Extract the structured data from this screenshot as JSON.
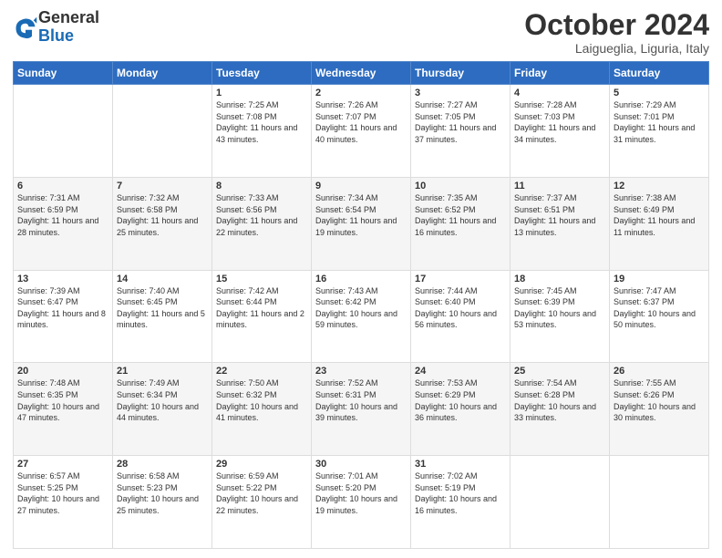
{
  "logo": {
    "line1": "General",
    "line2": "Blue"
  },
  "header": {
    "month": "October 2024",
    "location": "Laigueglia, Liguria, Italy"
  },
  "weekdays": [
    "Sunday",
    "Monday",
    "Tuesday",
    "Wednesday",
    "Thursday",
    "Friday",
    "Saturday"
  ],
  "weeks": [
    [
      {
        "day": null,
        "info": null
      },
      {
        "day": null,
        "info": null
      },
      {
        "day": "1",
        "info": "Sunrise: 7:25 AM\nSunset: 7:08 PM\nDaylight: 11 hours and 43 minutes."
      },
      {
        "day": "2",
        "info": "Sunrise: 7:26 AM\nSunset: 7:07 PM\nDaylight: 11 hours and 40 minutes."
      },
      {
        "day": "3",
        "info": "Sunrise: 7:27 AM\nSunset: 7:05 PM\nDaylight: 11 hours and 37 minutes."
      },
      {
        "day": "4",
        "info": "Sunrise: 7:28 AM\nSunset: 7:03 PM\nDaylight: 11 hours and 34 minutes."
      },
      {
        "day": "5",
        "info": "Sunrise: 7:29 AM\nSunset: 7:01 PM\nDaylight: 11 hours and 31 minutes."
      }
    ],
    [
      {
        "day": "6",
        "info": "Sunrise: 7:31 AM\nSunset: 6:59 PM\nDaylight: 11 hours and 28 minutes."
      },
      {
        "day": "7",
        "info": "Sunrise: 7:32 AM\nSunset: 6:58 PM\nDaylight: 11 hours and 25 minutes."
      },
      {
        "day": "8",
        "info": "Sunrise: 7:33 AM\nSunset: 6:56 PM\nDaylight: 11 hours and 22 minutes."
      },
      {
        "day": "9",
        "info": "Sunrise: 7:34 AM\nSunset: 6:54 PM\nDaylight: 11 hours and 19 minutes."
      },
      {
        "day": "10",
        "info": "Sunrise: 7:35 AM\nSunset: 6:52 PM\nDaylight: 11 hours and 16 minutes."
      },
      {
        "day": "11",
        "info": "Sunrise: 7:37 AM\nSunset: 6:51 PM\nDaylight: 11 hours and 13 minutes."
      },
      {
        "day": "12",
        "info": "Sunrise: 7:38 AM\nSunset: 6:49 PM\nDaylight: 11 hours and 11 minutes."
      }
    ],
    [
      {
        "day": "13",
        "info": "Sunrise: 7:39 AM\nSunset: 6:47 PM\nDaylight: 11 hours and 8 minutes."
      },
      {
        "day": "14",
        "info": "Sunrise: 7:40 AM\nSunset: 6:45 PM\nDaylight: 11 hours and 5 minutes."
      },
      {
        "day": "15",
        "info": "Sunrise: 7:42 AM\nSunset: 6:44 PM\nDaylight: 11 hours and 2 minutes."
      },
      {
        "day": "16",
        "info": "Sunrise: 7:43 AM\nSunset: 6:42 PM\nDaylight: 10 hours and 59 minutes."
      },
      {
        "day": "17",
        "info": "Sunrise: 7:44 AM\nSunset: 6:40 PM\nDaylight: 10 hours and 56 minutes."
      },
      {
        "day": "18",
        "info": "Sunrise: 7:45 AM\nSunset: 6:39 PM\nDaylight: 10 hours and 53 minutes."
      },
      {
        "day": "19",
        "info": "Sunrise: 7:47 AM\nSunset: 6:37 PM\nDaylight: 10 hours and 50 minutes."
      }
    ],
    [
      {
        "day": "20",
        "info": "Sunrise: 7:48 AM\nSunset: 6:35 PM\nDaylight: 10 hours and 47 minutes."
      },
      {
        "day": "21",
        "info": "Sunrise: 7:49 AM\nSunset: 6:34 PM\nDaylight: 10 hours and 44 minutes."
      },
      {
        "day": "22",
        "info": "Sunrise: 7:50 AM\nSunset: 6:32 PM\nDaylight: 10 hours and 41 minutes."
      },
      {
        "day": "23",
        "info": "Sunrise: 7:52 AM\nSunset: 6:31 PM\nDaylight: 10 hours and 39 minutes."
      },
      {
        "day": "24",
        "info": "Sunrise: 7:53 AM\nSunset: 6:29 PM\nDaylight: 10 hours and 36 minutes."
      },
      {
        "day": "25",
        "info": "Sunrise: 7:54 AM\nSunset: 6:28 PM\nDaylight: 10 hours and 33 minutes."
      },
      {
        "day": "26",
        "info": "Sunrise: 7:55 AM\nSunset: 6:26 PM\nDaylight: 10 hours and 30 minutes."
      }
    ],
    [
      {
        "day": "27",
        "info": "Sunrise: 6:57 AM\nSunset: 5:25 PM\nDaylight: 10 hours and 27 minutes."
      },
      {
        "day": "28",
        "info": "Sunrise: 6:58 AM\nSunset: 5:23 PM\nDaylight: 10 hours and 25 minutes."
      },
      {
        "day": "29",
        "info": "Sunrise: 6:59 AM\nSunset: 5:22 PM\nDaylight: 10 hours and 22 minutes."
      },
      {
        "day": "30",
        "info": "Sunrise: 7:01 AM\nSunset: 5:20 PM\nDaylight: 10 hours and 19 minutes."
      },
      {
        "day": "31",
        "info": "Sunrise: 7:02 AM\nSunset: 5:19 PM\nDaylight: 10 hours and 16 minutes."
      },
      {
        "day": null,
        "info": null
      },
      {
        "day": null,
        "info": null
      }
    ]
  ]
}
